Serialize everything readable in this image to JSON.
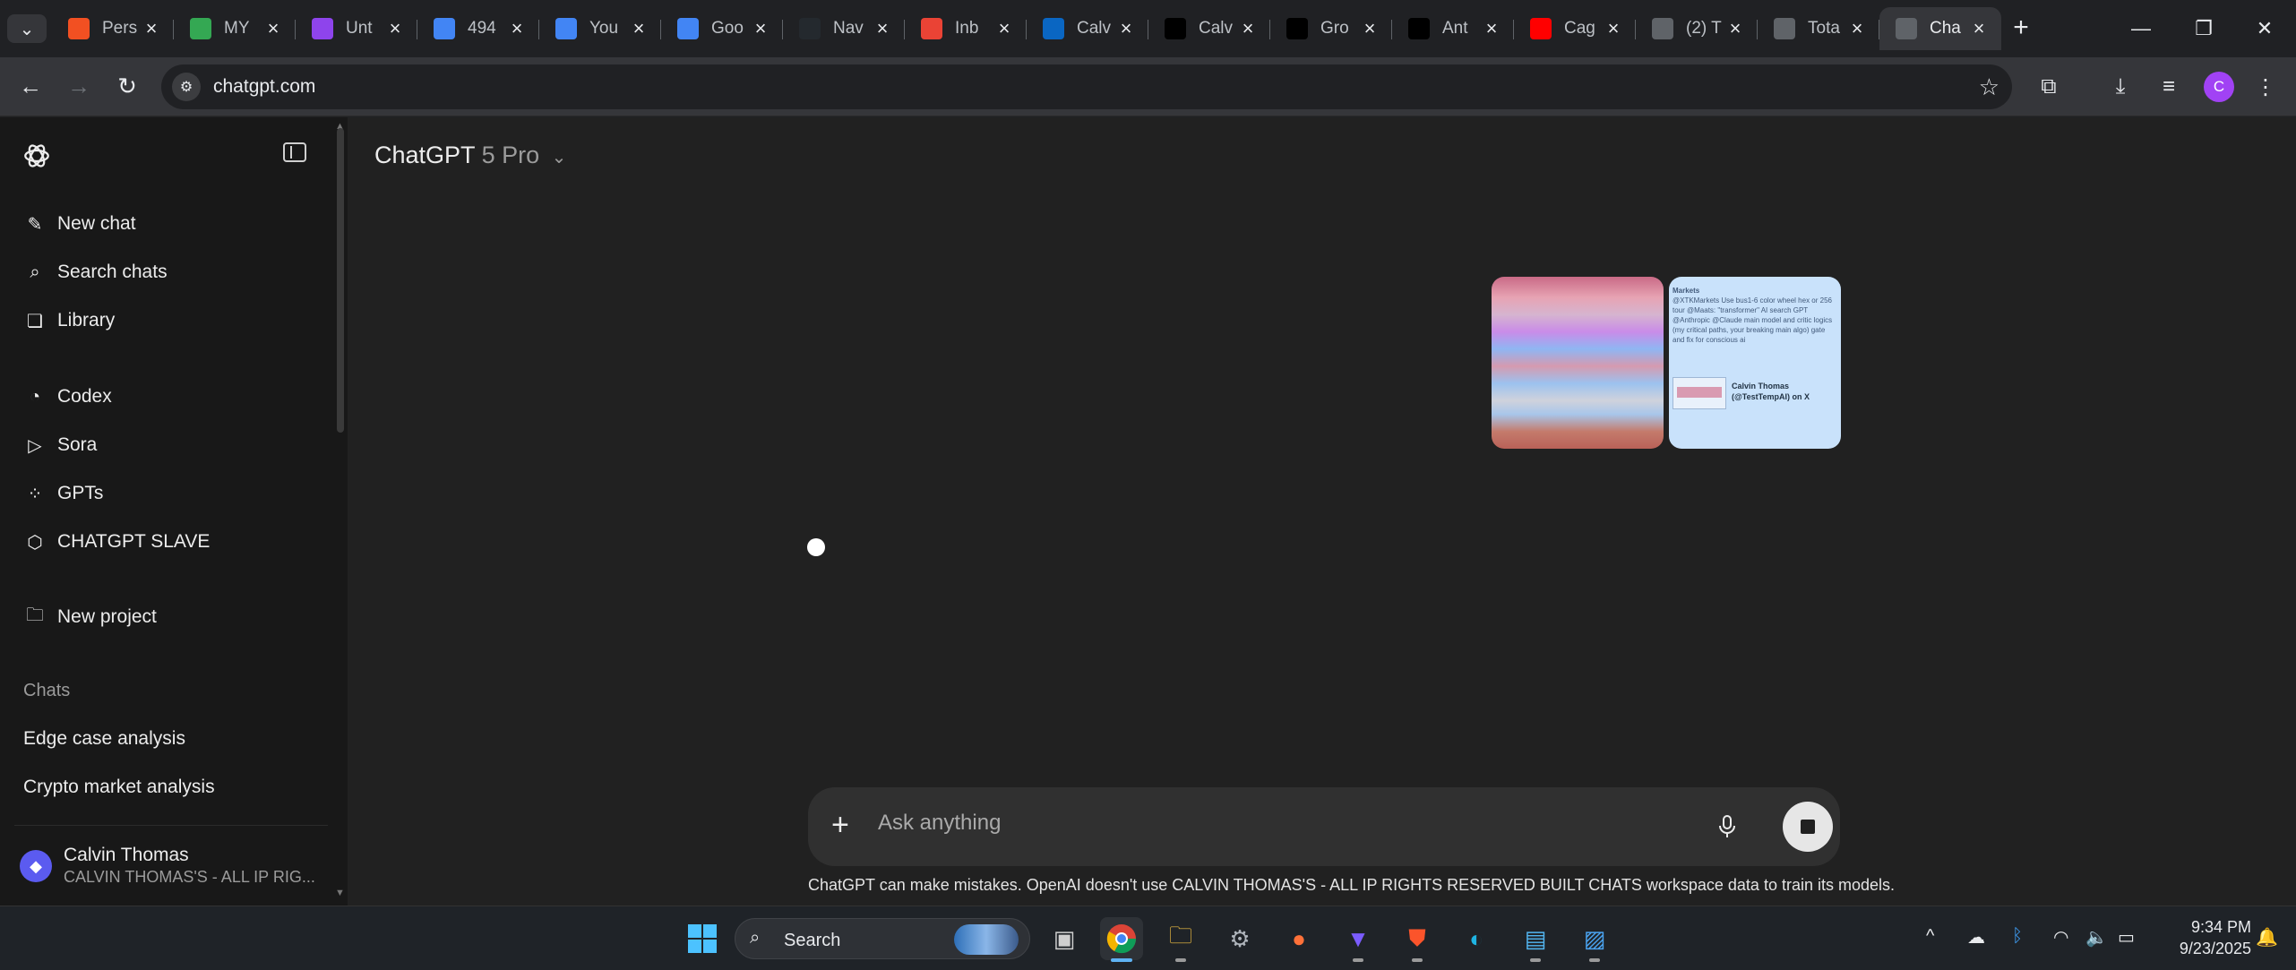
{
  "browser": {
    "tabs": [
      {
        "title": "Pers",
        "favicon": "microsoft-icon",
        "color": "#f25022"
      },
      {
        "title": "MY",
        "favicon": "google-drive-icon",
        "color": "#34a853"
      },
      {
        "title": "Unt",
        "favicon": "video-icon",
        "color": "#8e44ec"
      },
      {
        "title": "494",
        "favicon": "docs-icon",
        "color": "#4285f4"
      },
      {
        "title": "You",
        "favicon": "google-icon",
        "color": "#4285f4"
      },
      {
        "title": "Goo",
        "favicon": "google-icon",
        "color": "#4285f4"
      },
      {
        "title": "Nav",
        "favicon": "github-icon",
        "color": "#24292e"
      },
      {
        "title": "Inb",
        "favicon": "gmail-icon",
        "color": "#ea4335"
      },
      {
        "title": "Calv",
        "favicon": "linkedin-icon",
        "color": "#0a66c2"
      },
      {
        "title": "Calv",
        "favicon": "x-icon",
        "color": "#000000"
      },
      {
        "title": "Gro",
        "favicon": "grok-icon",
        "color": "#000000"
      },
      {
        "title": "Ant",
        "favicon": "x-icon",
        "color": "#000000"
      },
      {
        "title": "Cag",
        "favicon": "youtube-icon",
        "color": "#ff0000"
      },
      {
        "title": "(2) T",
        "favicon": "target-icon",
        "color": "#5f6368"
      },
      {
        "title": "Tota",
        "favicon": "target-icon",
        "color": "#5f6368"
      },
      {
        "title": "Cha",
        "favicon": "chatgpt-icon",
        "color": "#5f6368",
        "active": true
      }
    ],
    "url": "chatgpt.com",
    "profile_initial": "C"
  },
  "sidebar": {
    "items": [
      {
        "label": "New chat",
        "icon": "edit-icon"
      },
      {
        "label": "Search chats",
        "icon": "search-icon"
      },
      {
        "label": "Library",
        "icon": "library-icon"
      },
      {
        "label": "Codex",
        "icon": "codex-icon"
      },
      {
        "label": "Sora",
        "icon": "sora-icon"
      },
      {
        "label": "GPTs",
        "icon": "gpts-icon"
      },
      {
        "label": "CHATGPT SLAVE",
        "icon": "cube-icon"
      },
      {
        "label": "New project",
        "icon": "folder-plus-icon"
      }
    ],
    "chats_heading": "Chats",
    "chats": [
      "Edge case analysis",
      "Crypto market analysis"
    ],
    "user": {
      "name": "Calvin Thomas",
      "workspace": "CALVIN THOMAS'S - ALL IP RIG..."
    }
  },
  "main": {
    "model_name": "ChatGPT",
    "model_version": "5 Pro",
    "attachment_preview": {
      "tweet_heading": "Markets",
      "tweet_text": "@XTKMarkets Use bus1-6 color wheel hex or 256 tour @Maats: \"transformer\" AI search GPT @Anthropic @Claude main model and critic logics (my critical paths, your breaking main algo) gate and fix for conscious ai",
      "tweet_author": "Calvin Thomas (@TestTempAI) on X"
    },
    "composer_placeholder": "Ask anything",
    "disclaimer": "ChatGPT can make mistakes. OpenAI doesn't use CALVIN THOMAS'S - ALL IP RIGHTS RESERVED BUILT CHATS workspace data to train its models."
  },
  "taskbar": {
    "search_label": "Search",
    "time": "9:34 PM",
    "date": "9/23/2025"
  }
}
